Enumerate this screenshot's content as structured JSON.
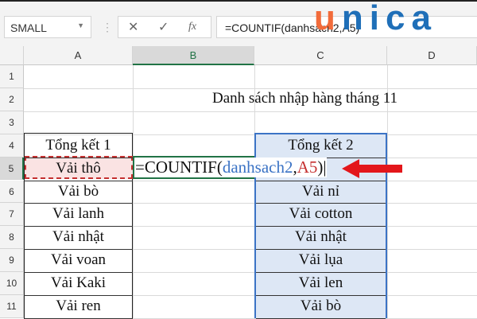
{
  "name_box": "SMALL",
  "formula_bar": "=COUNTIF(danhsach2,A5)",
  "logo": {
    "u": "u",
    "rest": "nica"
  },
  "columns": [
    "A",
    "B",
    "C",
    "D"
  ],
  "rows": [
    "1",
    "2",
    "3",
    "4",
    "5",
    "6",
    "7",
    "8",
    "9",
    "10",
    "11"
  ],
  "title": "Danh sách nhập hàng tháng 11",
  "list1": [
    "Tổng kết 1",
    "Vải thô",
    "Vải bò",
    "Vải lanh",
    "Vải nhật",
    "Vải voan",
    "Vải Kaki",
    "Vải ren"
  ],
  "list2": [
    "Tổng kết 2",
    "",
    "Vải nỉ",
    "Vải cotton",
    "Vải nhật",
    "Vải lụa",
    "Vải len",
    "Vải bò"
  ],
  "formula": {
    "prefix": "=COUNTIF(",
    "ref1": "danhsach2",
    "comma": ",",
    "ref2": "A5",
    "suffix": ")"
  },
  "colors": {
    "excel_green": "#217346",
    "ref_blue": "#3b73c5",
    "ref_red": "#c53030",
    "arrow": "#e3161b"
  }
}
